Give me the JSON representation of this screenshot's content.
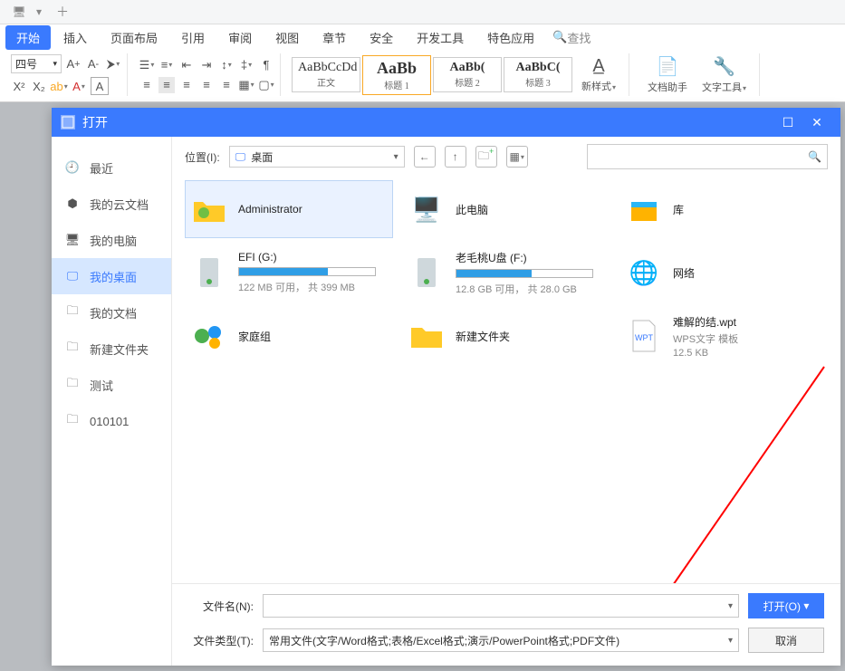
{
  "menu": {
    "tabs": [
      "开始",
      "插入",
      "页面布局",
      "引用",
      "审阅",
      "视图",
      "章节",
      "安全",
      "开发工具",
      "特色应用"
    ],
    "search": "查找"
  },
  "ribbon": {
    "fontSize": "四号",
    "styles": [
      {
        "prev": "AaBbCcDd",
        "label": "正文"
      },
      {
        "prev": "AaBb",
        "label": "标题 1"
      },
      {
        "prev": "AaBb(",
        "label": "标题 2"
      },
      {
        "prev": "AaBbC(",
        "label": "标题 3"
      }
    ],
    "newStyle": "新样式",
    "docHelper": "文档助手",
    "textTool": "文字工具"
  },
  "dialog": {
    "title": "打开",
    "sidebar": [
      {
        "icon": "clock",
        "label": "最近"
      },
      {
        "icon": "cloud",
        "label": "我的云文档"
      },
      {
        "icon": "pc",
        "label": "我的电脑"
      },
      {
        "icon": "desktop",
        "label": "我的桌面"
      },
      {
        "icon": "folder",
        "label": "我的文档"
      },
      {
        "icon": "folder",
        "label": "新建文件夹"
      },
      {
        "icon": "folder",
        "label": "测试"
      },
      {
        "icon": "folder",
        "label": "010101"
      }
    ],
    "locationLabel": "位置(I):",
    "location": "桌面",
    "items": [
      {
        "slot": 0,
        "icon": "user-folder",
        "name": "Administrator"
      },
      {
        "slot": 1,
        "icon": "monitor",
        "name": "此电脑"
      },
      {
        "slot": 2,
        "icon": "library",
        "name": "库"
      },
      {
        "slot": 3,
        "icon": "drive",
        "name": "EFI (G:)",
        "bar": 0.65,
        "sub": "122 MB 可用， 共 399 MB"
      },
      {
        "slot": 4,
        "icon": "drive",
        "name": "老毛桃U盘 (F:)",
        "bar": 0.55,
        "sub": "12.8 GB 可用， 共 28.0 GB"
      },
      {
        "slot": 5,
        "icon": "network",
        "name": "网络"
      },
      {
        "slot": 6,
        "icon": "homegroup",
        "name": "家庭组"
      },
      {
        "slot": 7,
        "icon": "folder",
        "name": "新建文件夹"
      },
      {
        "slot": 8,
        "icon": "wpt",
        "name": "难解的结.wpt",
        "sub": "WPS文字 模板",
        "sub2": "12.5 KB"
      }
    ],
    "footer": {
      "fileNameLabel": "文件名(N):",
      "fileName": "",
      "fileTypeLabel": "文件类型(T):",
      "fileType": "常用文件(文字/Word格式;表格/Excel格式;演示/PowerPoint格式;PDF文件)",
      "open": "打开(O)",
      "cancel": "取消"
    }
  }
}
